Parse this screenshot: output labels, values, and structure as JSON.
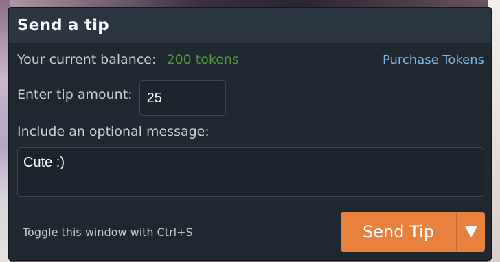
{
  "dialog": {
    "title": "Send a tip",
    "balance_label": "Your current balance:",
    "balance_value": "200 tokens",
    "purchase_link": "Purchase Tokens",
    "amount_label": "Enter tip amount:",
    "amount_value": "25",
    "message_label": "Include an optional message:",
    "message_value": "Cute :)",
    "toggle_hint": "Toggle this window with Ctrl+S",
    "send_label": "Send Tip"
  },
  "icons": {
    "dropdown": "caret-down-icon"
  },
  "colors": {
    "accent": "#e8813e",
    "balance": "#4f9a3c",
    "link": "#7fb4e6",
    "panel": "#1f2730",
    "header": "#2b3642"
  }
}
